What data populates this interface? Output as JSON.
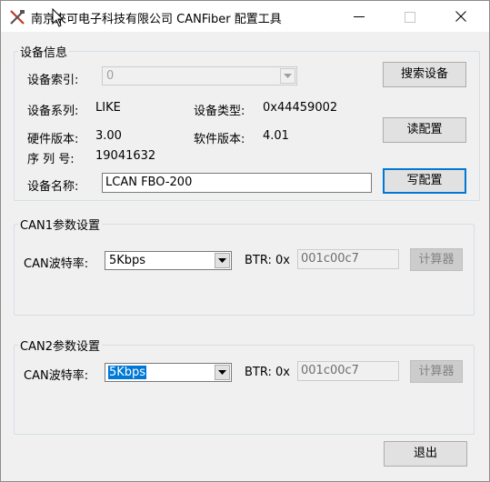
{
  "window": {
    "title": "南京來可电子科技有限公司 CANFiber 配置工具",
    "icon": "tools-icon",
    "controls": [
      "minimize-icon",
      "maximize-icon",
      "close-icon"
    ]
  },
  "device_info": {
    "group_title": "设备信息",
    "index_label": "设备索引:",
    "index_value": "0",
    "series_label": "设备系列:",
    "series_value": "LIKE",
    "type_label": "设备类型:",
    "type_value": "0x44459002",
    "hw_label": "硬件版本:",
    "hw_value": "3.00",
    "sw_label": "软件版本:",
    "sw_value": "4.01",
    "serial_label": "序 列 号:",
    "serial_value": "19041632",
    "name_label": "设备名称:",
    "name_value": "LCAN FBO-200",
    "search_button": "搜索设备",
    "read_button": "读配置",
    "write_button": "写配置"
  },
  "can1": {
    "group_title": "CAN1参数设置",
    "baud_label": "CAN波特率:",
    "baud_value": "5Kbps",
    "btr_label": "BTR: 0x",
    "btr_value": "001c00c7",
    "calc_button": "计算器"
  },
  "can2": {
    "group_title": "CAN2参数设置",
    "baud_label": "CAN波特率:",
    "baud_value": "5Kbps",
    "btr_label": "BTR: 0x",
    "btr_value": "001c00c7",
    "calc_button": "计算器"
  },
  "footer": {
    "exit_button": "退出"
  },
  "colors": {
    "window_bg": "#f0f0f0",
    "accent": "#0078d7",
    "button_bg": "#e1e1e1",
    "group_border": "#d5dfe5"
  }
}
